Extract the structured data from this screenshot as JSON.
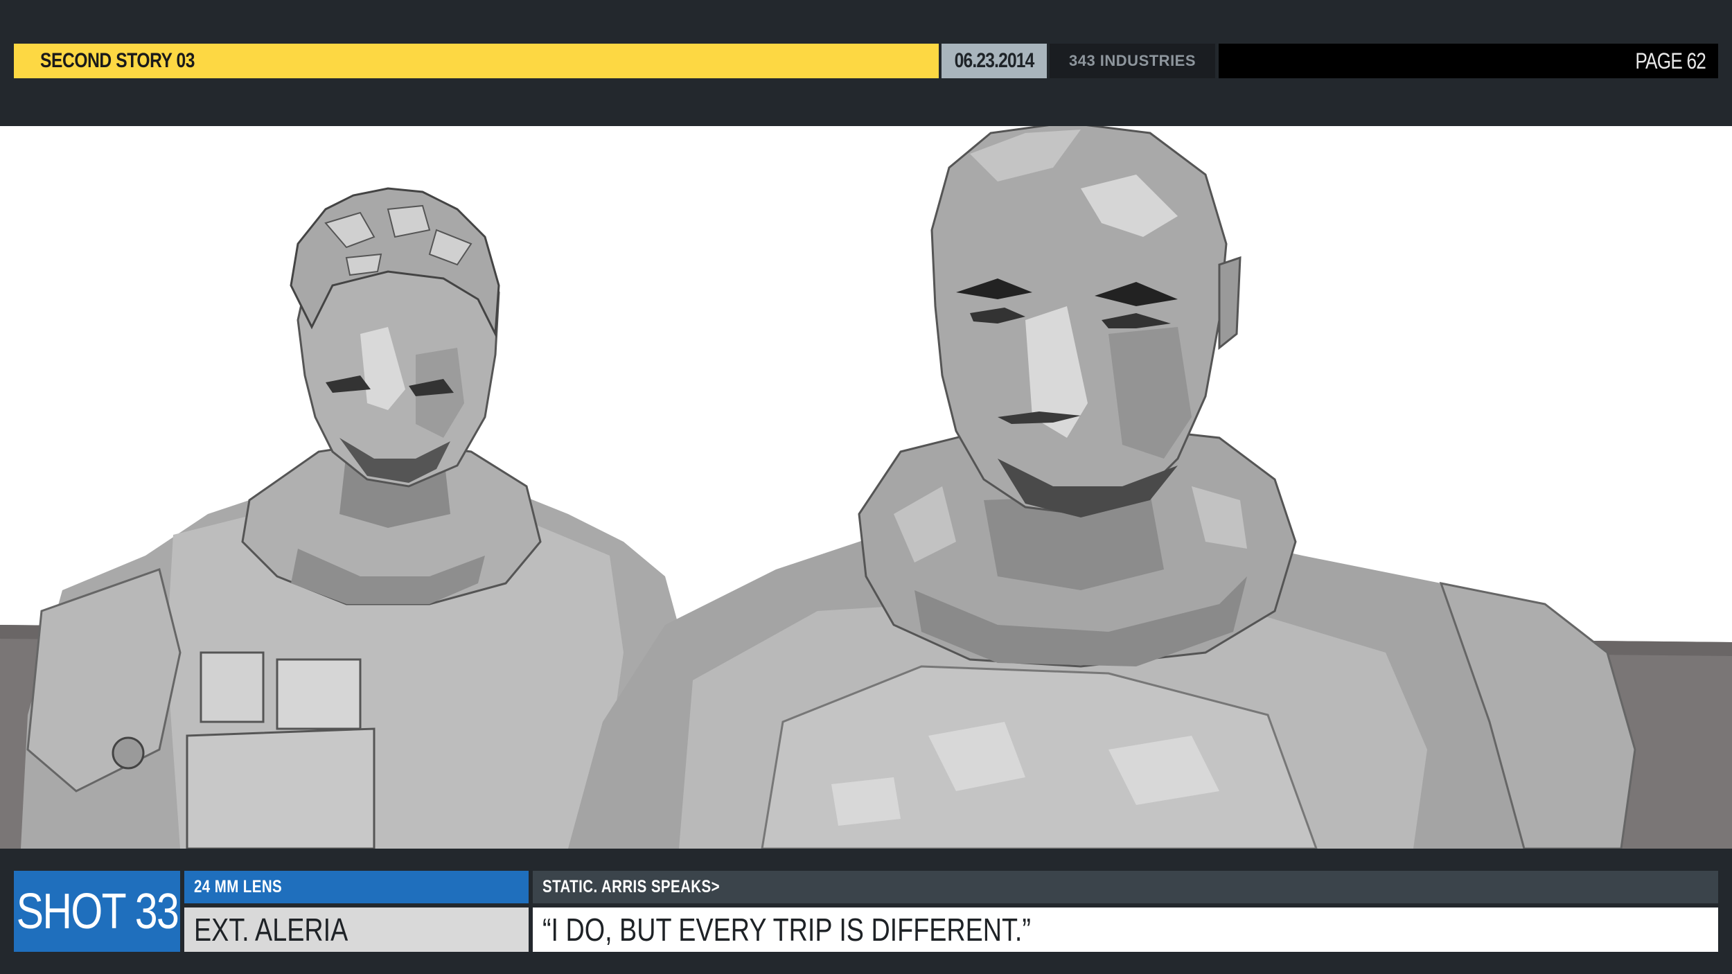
{
  "header": {
    "title": "SECOND STORY 03",
    "date": "06.23.2014",
    "studio": "343 INDUSTRIES",
    "page": "PAGE 62"
  },
  "scene": {
    "image": "storyboard-panel-two-soldiers-in-armor"
  },
  "footer": {
    "shot": "SHOT 33",
    "lens": "24 MM LENS",
    "location": "EXT.  ALERIA",
    "action": "STATIC.  ARRIS SPEAKS>",
    "dialogue": "“I DO, BUT EVERY TRIP IS DIFFERENT.”"
  },
  "colors": {
    "title_bar": "#fdd843",
    "date_bar": "#a9b5bd",
    "shot_blue": "#1f6fbd",
    "frame_dark": "#23282d"
  }
}
